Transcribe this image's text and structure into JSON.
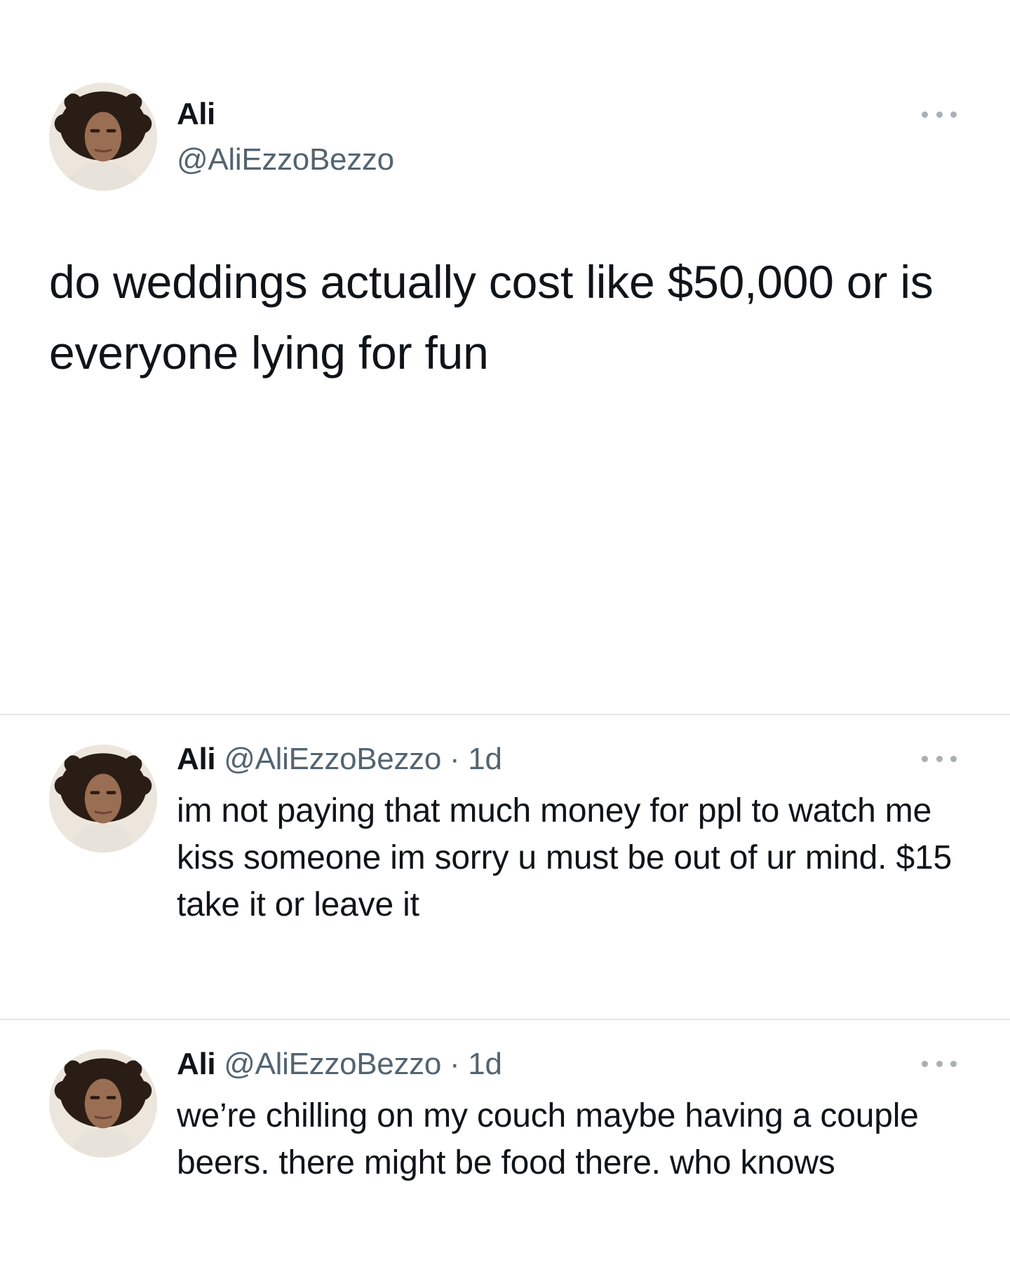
{
  "main_tweet": {
    "display_name": "Ali",
    "handle": "@AliEzzoBezzo",
    "text": "do weddings actually cost like $50,000 or is everyone lying for fun"
  },
  "replies": [
    {
      "display_name": "Ali",
      "handle": "@AliEzzoBezzo",
      "separator": "·",
      "time": "1d",
      "text": "im not paying that much money for ppl to watch me kiss someone im sorry u must be out of ur mind. $15 take it or leave it"
    },
    {
      "display_name": "Ali",
      "handle": "@AliEzzoBezzo",
      "separator": "·",
      "time": "1d",
      "text": "we’re chilling on my couch maybe having a couple beers. there might be food there. who knows"
    }
  ],
  "icons": {
    "more": "more-horizontal-icon",
    "avatar": "profile-photo"
  },
  "colors": {
    "text_primary": "#0f1419",
    "text_secondary": "#536471",
    "divider": "#e3e6e9",
    "icon_gray": "#a8afb6",
    "background": "#ffffff"
  }
}
